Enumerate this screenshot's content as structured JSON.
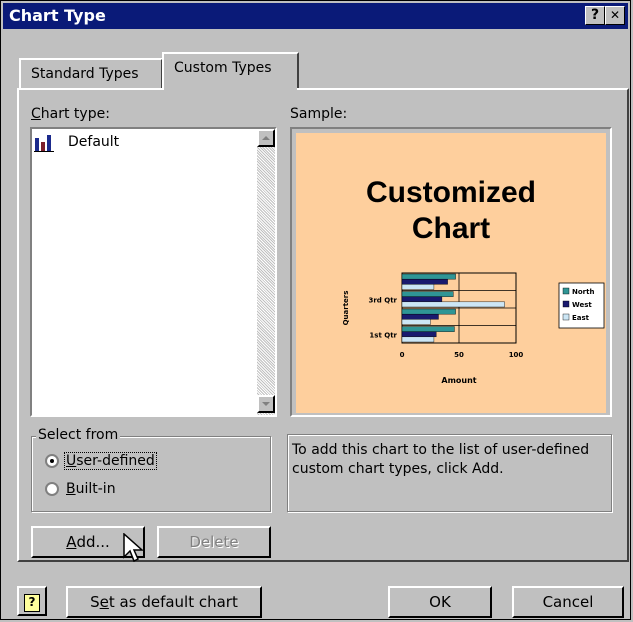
{
  "window": {
    "title": "Chart Type",
    "help_glyph": "?",
    "close_glyph": "✕"
  },
  "tabs": [
    {
      "label": "Standard Types"
    },
    {
      "label": "Custom Types"
    }
  ],
  "chart_type": {
    "label_prefix": "C",
    "label_rest": "hart type:",
    "items": [
      {
        "label": "Default"
      }
    ]
  },
  "sample": {
    "label": "Sample:",
    "title_line1": "Customized",
    "title_line2": "Chart",
    "bg_color": "#fecf9d"
  },
  "chart_data": {
    "type": "bar",
    "orientation": "horizontal",
    "categories": [
      "1st Qtr",
      "",
      "3rd Qtr",
      ""
    ],
    "series": [
      {
        "name": "North",
        "values": [
          46,
          47,
          45,
          47
        ],
        "color": "#2f9595"
      },
      {
        "name": "West",
        "values": [
          30,
          32,
          35,
          40
        ],
        "color": "#1a1a6e"
      },
      {
        "name": "East",
        "values": [
          28,
          25,
          90,
          28
        ],
        "color": "#cce6f5"
      }
    ],
    "title": "",
    "xlabel": "Amount",
    "ylabel": "Quarters",
    "xlim": [
      0,
      100
    ],
    "xticks": [
      "0",
      "50",
      "100"
    ],
    "legend_position": "right"
  },
  "select_from": {
    "label": "Select from",
    "options": [
      {
        "label_prefix": "U",
        "label_rest": "ser-defined",
        "selected": true
      },
      {
        "label_prefix": "B",
        "label_rest": "uilt-in",
        "selected": false
      }
    ]
  },
  "description": "To add this chart to the list of user-defined custom chart types, click Add.",
  "buttons": {
    "add_prefix": "A",
    "add_rest": "dd...",
    "delete": "Delete",
    "set_default_pre": "S",
    "set_default_ul": "e",
    "set_default_rest": "t as default chart",
    "ok": "OK",
    "cancel": "Cancel",
    "help_glyph": "?"
  }
}
